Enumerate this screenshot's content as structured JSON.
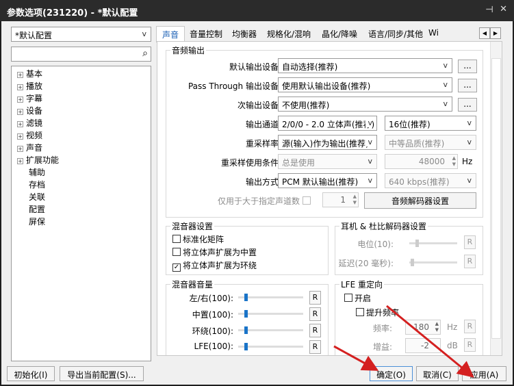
{
  "window": {
    "title": "参数选项(231220) - *默认配置",
    "pin_icon": "pin-icon",
    "close_icon": "close-icon"
  },
  "sidebar": {
    "profile": "*默认配置",
    "search_placeholder": "",
    "tree": [
      {
        "label": "基本",
        "expandable": true
      },
      {
        "label": "播放",
        "expandable": true
      },
      {
        "label": "字幕",
        "expandable": true
      },
      {
        "label": "设备",
        "expandable": true
      },
      {
        "label": "滤镜",
        "expandable": true
      },
      {
        "label": "视频",
        "expandable": true
      },
      {
        "label": "声音",
        "expandable": true
      },
      {
        "label": "扩展功能",
        "expandable": true
      },
      {
        "label": "辅助",
        "expandable": false
      },
      {
        "label": "存档",
        "expandable": false
      },
      {
        "label": "关联",
        "expandable": false
      },
      {
        "label": "配置",
        "expandable": false
      },
      {
        "label": "屏保",
        "expandable": false
      }
    ]
  },
  "tabs": [
    "声音",
    "音量控制",
    "均衡器",
    "规格化/混响",
    "晶化/降噪",
    "语言/同步/其他",
    "Wi"
  ],
  "audio_output": {
    "title": "音频输出",
    "default_device_label": "默认输出设备:",
    "default_device": "自动选择(推荐)",
    "passthrough_label": "Pass Through 输出设备:",
    "passthrough": "使用默认输出设备(推荐)",
    "secondary_label": "次输出设备:",
    "secondary": "不使用(推荐)",
    "more": "...",
    "channel_label": "输出通道:",
    "channel": "2/0/0 - 2.0 立体声(推荐)",
    "bits": "16位(推荐)",
    "resample_label": "重采样率:",
    "resample": "源(输入)作为输出(推荐)",
    "quality": "中等品质(推荐)",
    "condition_label": "重采样使用条件:",
    "condition": "总是使用",
    "rate": "48000",
    "hz": "Hz",
    "method_label": "输出方式:",
    "method": "PCM 默认输出(推荐)",
    "bitrate": "640 kbps(推荐)",
    "only_label": "仅用于大于指定声道数",
    "only_value": "1",
    "decoder_button": "音频解码器设置"
  },
  "mixer": {
    "title": "混音器设置",
    "options": [
      {
        "label": "标准化矩阵",
        "checked": false
      },
      {
        "label": "将立体声扩展为中置",
        "checked": false
      },
      {
        "label": "将立体声扩展为环绕",
        "checked": true
      }
    ]
  },
  "headphone": {
    "title": "耳机 & 杜比解码器设置",
    "level_label": "电位(10):",
    "delay_label": "延迟(20 毫秒):",
    "reset": "R"
  },
  "mixer_volume": {
    "title": "混音器音量",
    "items": [
      {
        "label": "左/右(100):",
        "value": 100
      },
      {
        "label": "中置(100):",
        "value": 100
      },
      {
        "label": "环绕(100):",
        "value": 100
      },
      {
        "label": "LFE(100):",
        "value": 100
      }
    ],
    "reset": "R"
  },
  "lfe": {
    "title": "LFE 重定向",
    "enable": "开启",
    "boost": "提升频率",
    "freq_label": "频率:",
    "freq": "180",
    "freq_unit": "Hz",
    "gain_label": "增益:",
    "gain": "-2",
    "gain_unit": "dB",
    "reset": "R"
  },
  "footer": {
    "init": "初始化(I)",
    "export": "导出当前配置(S)...",
    "ok": "确定(O)",
    "cancel": "取消(C)",
    "apply": "应用(A)"
  },
  "colors": {
    "accent": "#1a74c8",
    "titlebar": "#2b2b2b",
    "arrow": "#d42020"
  }
}
